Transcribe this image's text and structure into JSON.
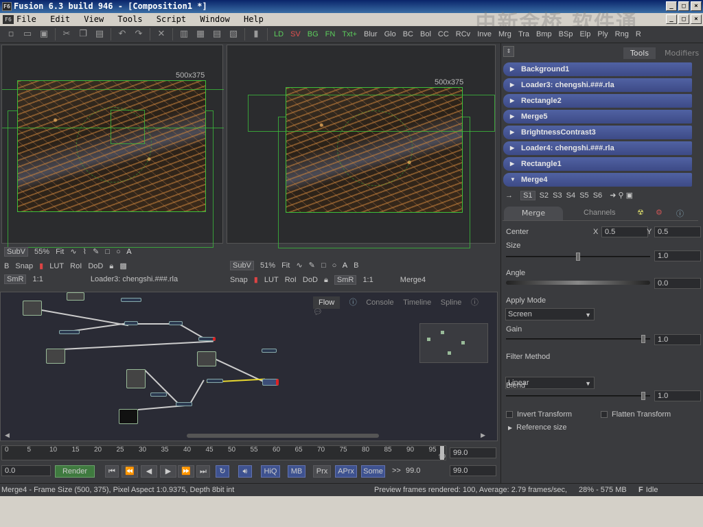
{
  "window": {
    "title": "Fusion 6.3 build 946 - [Composition1 *]",
    "logo": "F6"
  },
  "menu": [
    "File",
    "Edit",
    "View",
    "Tools",
    "Script",
    "Window",
    "Help"
  ],
  "watermark": "中新金桥 软件通",
  "toolbar": {
    "tools": [
      "LD",
      "SV",
      "BG",
      "FN",
      "Txt+",
      "Blur",
      "Glo",
      "BC",
      "Bol",
      "CC",
      "RCv",
      "Inve",
      "Mrg",
      "Tra",
      "Bmp",
      "BSp",
      "Elp",
      "Ply",
      "Rng",
      "R"
    ],
    "tool_colors": {
      "LD": "#5ccf5c",
      "SV": "#e05050",
      "BG": "#5ccf5c",
      "FN": "#5ccf5c",
      "Txt+": "#5ccf5c"
    }
  },
  "viewers": {
    "left": {
      "resolution": "500x375",
      "subv": "SubV",
      "zoom": "55%",
      "fit": "Fit",
      "b": "B",
      "snap": "Snap",
      "lut": "LUT",
      "roi": "RoI",
      "dod": "DoD",
      "smr": "SmR",
      "ratio": "1:1",
      "label": "Loader3: chengshi.###.rla"
    },
    "right": {
      "resolution": "500x375",
      "subv": "SubV",
      "zoom": "51%",
      "fit": "Fit",
      "b": "B",
      "snap": "Snap",
      "lut": "LUT",
      "roi": "RoI",
      "dod": "DoD",
      "smr": "SmR",
      "ratio": "1:1",
      "label": "Merge4"
    }
  },
  "flow": {
    "tabs": [
      "Flow",
      "Console",
      "Timeline",
      "Spline"
    ]
  },
  "panel": {
    "tabs": [
      "Tools",
      "Modifiers"
    ],
    "tools": [
      "Background1",
      "Loader3: chengshi.###.rla",
      "Rectangle2",
      "Merge5",
      "BrightnessContrast3",
      "Loader4: chengshi.###.rla",
      "Rectangle1",
      "Merge4"
    ],
    "scenes": [
      "S1",
      "S2",
      "S3",
      "S4",
      "S5",
      "S6"
    ],
    "subtabs": [
      "Merge",
      "Channels"
    ],
    "center_label": "Center",
    "x_label": "X",
    "x": "0.5",
    "y_label": "Y",
    "y": "0.5",
    "size_label": "Size",
    "size": "1.0",
    "angle_label": "Angle",
    "angle": "0.0",
    "apply_mode_label": "Apply Mode",
    "apply_mode": "Screen",
    "gain_label": "Gain",
    "gain": "1.0",
    "filter_label": "Filter Method",
    "filter": "Linear",
    "blend_label": "Blend",
    "blend": "1.0",
    "invert_transform": "Invert Transform",
    "flatten_transform": "Flatten Transform",
    "reference_size": "Reference size"
  },
  "timeline": {
    "ticks": [
      "0",
      "5",
      "10",
      "15",
      "20",
      "25",
      "30",
      "35",
      "40",
      "45",
      "50",
      "55",
      "60",
      "65",
      "70",
      "75",
      "80",
      "85",
      "90",
      "95"
    ],
    "end_marker": "99",
    "end_value": "99.0",
    "start_value": "0.0",
    "render": "Render",
    "hiq": "HiQ",
    "mb": "MB",
    "prx": "Prx",
    "aprx": "APrx",
    "some": "Some",
    "ff": ">>",
    "current": "99.0",
    "render_end": "99.0"
  },
  "status": {
    "left": "Merge4 - Frame Size (500, 375), Pixel Aspect 1:0.9375, Depth 8bit int",
    "middle": "Preview frames rendered: 100,  Average: 2.79 frames/sec,",
    "memory": "28% - 575 MB",
    "state": "Idle"
  }
}
